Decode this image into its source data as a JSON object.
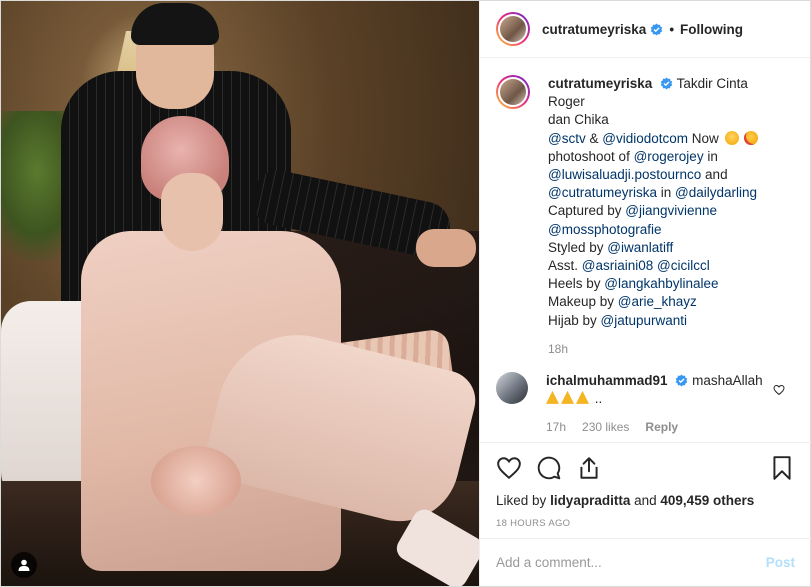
{
  "photo": {
    "alt_icon": "user-tag-icon"
  },
  "header": {
    "username": "cutratumeyriska",
    "separator": "•",
    "follow_status": "Following"
  },
  "caption": {
    "username": "cutratumeyriska",
    "lines": [
      "Takdir Cinta Roger",
      "dan Chika",
      "@sctv & @vidiodotcom Now",
      "photoshoot of @rogerojey in",
      "@luwisaluadji.postournco and",
      "@cutratumeyriska in @dailydarling",
      "Captured by @jiangvivienne",
      "@mossphotografie",
      "Styled by @iwanlatiff",
      "Asst. @asriaini08 @cicilccl",
      "Heels by @langkahbylinalee",
      "Makeup by @arie_khayz",
      "Hijab by @jatupurwanti"
    ],
    "time": "18h"
  },
  "comment": {
    "username": "ichalmuhammad91",
    "text": "mashaAllah",
    "suffix": "..",
    "time": "17h",
    "likes": "230 likes",
    "reply": "Reply"
  },
  "actions": {
    "icons": [
      "heart-icon",
      "comment-icon",
      "share-icon",
      "bookmark-icon"
    ],
    "liked_by_prefix": "Liked by",
    "liked_by_user": "lidyapraditta",
    "liked_by_and": "and",
    "liked_by_others": "409,459 others",
    "timestamp": "18 HOURS AGO"
  },
  "add_comment": {
    "placeholder": "Add a comment...",
    "post_label": "Post"
  },
  "colors": {
    "link": "#003569",
    "muted": "#8e8e8e",
    "post_disabled": "#b2dffc",
    "verified": "#3897f0"
  }
}
